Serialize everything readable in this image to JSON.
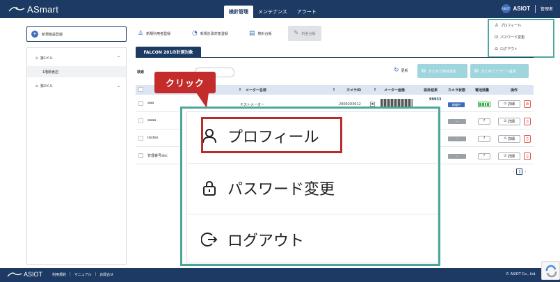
{
  "header": {
    "app_name": "ASmart",
    "nav_tabs": [
      "検針管理",
      "メンテナンス",
      "アラート"
    ],
    "brand_badge": "ASIOT",
    "brand_name": "ASIOT",
    "user_label": "管理者"
  },
  "dropdown": {
    "items": [
      "プロフィール",
      "パスワード変更",
      "ログアウト"
    ]
  },
  "left": {
    "new_facility_button": "新規施設登録",
    "tree": [
      {
        "label": "第1ビル",
        "expanded": true
      },
      {
        "label": "1階飲食店"
      },
      {
        "label": "第2ビル",
        "expanded": false
      }
    ]
  },
  "toolbar": {
    "new_user": "新規利用者登録",
    "new_meter_target": "新規計測対象登録",
    "meter_ledger": "検針台帳",
    "fee_ledger": "料金台帳"
  },
  "content": {
    "tab_title": "FALCON 201の計測対象",
    "search_label": "検索",
    "refresh_label": "更新",
    "bulk_meter_settings": "まとめて検針設定",
    "bulk_alert_settings": "まとめてアラート設定",
    "columns": [
      "メーター名称",
      "カメラID",
      "メーター画像",
      "検針結果",
      "カメラ状態",
      "電池残量",
      "操作"
    ],
    "rows": [
      {
        "name": "aaa",
        "meter_name": "テストメーター",
        "camera_id": "2009203012",
        "result": "99933",
        "camera_status": "稼働中"
      },
      {
        "name": "aaaa",
        "camera_status": "--",
        "battery": "?"
      },
      {
        "name": "testes",
        "camera_status": "--",
        "battery": "?"
      },
      {
        "name": "管理番号abc",
        "camera_status": "--",
        "battery": "?"
      }
    ],
    "detail_label": "詳細",
    "current_page": "1"
  },
  "callout": {
    "label": "クリック"
  },
  "footer": {
    "logo": "ASIOT",
    "links": [
      "利用規約",
      "マニュアル",
      "お問合せ"
    ],
    "copyright": "© ASIOT Co., Ltd."
  },
  "colors": {
    "navy": "#1c3a63",
    "accent_blue": "#3d6cb8",
    "teal_frame": "#4aa89a",
    "callout_red": "#c42b2b",
    "bulk_button": "#9fd5dd"
  }
}
